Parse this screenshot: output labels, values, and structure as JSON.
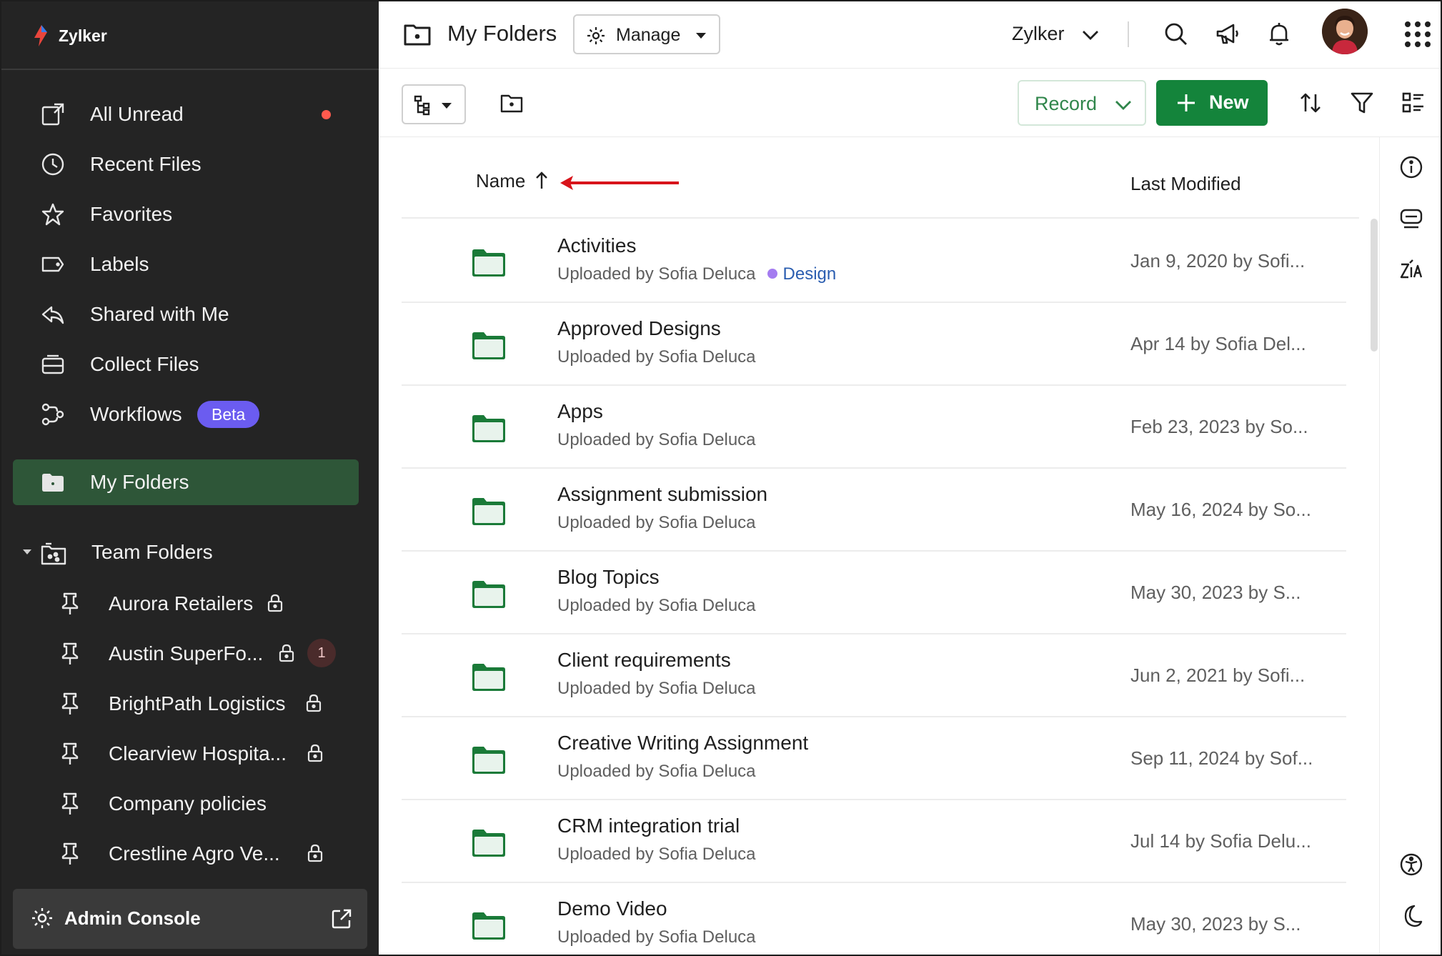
{
  "brand": {
    "name": "Zylker"
  },
  "sidebar": {
    "nav": [
      {
        "label": "All Unread",
        "icon": "all-unread-icon",
        "has_dot": true
      },
      {
        "label": "Recent Files",
        "icon": "clock-icon"
      },
      {
        "label": "Favorites",
        "icon": "star-icon"
      },
      {
        "label": "Labels",
        "icon": "label-icon"
      },
      {
        "label": "Shared with Me",
        "icon": "share-icon"
      },
      {
        "label": "Collect Files",
        "icon": "collect-icon"
      },
      {
        "label": "Workflows",
        "icon": "workflow-icon",
        "badge": "Beta"
      }
    ],
    "my_folders": {
      "label": "My Folders",
      "icon": "folder-icon",
      "active": true
    },
    "team_folders": {
      "label": "Team Folders",
      "items": [
        {
          "label": "Aurora Retailers",
          "locked": true
        },
        {
          "label": "Austin SuperFo...",
          "locked": true,
          "count": "1"
        },
        {
          "label": "BrightPath Logistics",
          "locked": true
        },
        {
          "label": "Clearview Hospita...",
          "locked": true
        },
        {
          "label": "Company policies",
          "locked": false
        },
        {
          "label": "Crestline Agro Ve...",
          "locked": true
        }
      ]
    },
    "admin": {
      "label": "Admin Console"
    }
  },
  "topbar": {
    "title": "My Folders",
    "manage_label": "Manage",
    "org_label": "Zylker"
  },
  "toolbar": {
    "record_label": "Record",
    "new_label": "New"
  },
  "list": {
    "col_name": "Name",
    "col_modified": "Last Modified",
    "rows": [
      {
        "name": "Activities",
        "sub": "Uploaded by Sofia Deluca",
        "tag": "Design",
        "modified": "Jan 9, 2020 by Sofi..."
      },
      {
        "name": "Approved Designs",
        "sub": "Uploaded by Sofia Deluca",
        "modified": "Apr 14 by Sofia Del..."
      },
      {
        "name": "Apps",
        "sub": "Uploaded by Sofia Deluca",
        "modified": "Feb 23, 2023 by So..."
      },
      {
        "name": "Assignment submission",
        "sub": "Uploaded by Sofia Deluca",
        "modified": "May 16, 2024 by So..."
      },
      {
        "name": "Blog Topics",
        "sub": "Uploaded by Sofia Deluca",
        "modified": "May 30, 2023 by S..."
      },
      {
        "name": "Client requirements",
        "sub": "Uploaded by Sofia Deluca",
        "modified": "Jun 2, 2021 by Sofi..."
      },
      {
        "name": "Creative Writing Assignment",
        "sub": "Uploaded by Sofia Deluca",
        "modified": "Sep 11, 2024 by Sof..."
      },
      {
        "name": "CRM integration trial",
        "sub": "Uploaded by Sofia Deluca",
        "modified": "Jul 14 by Sofia Delu..."
      },
      {
        "name": "Demo Video",
        "sub": "Uploaded by Sofia Deluca",
        "modified": "May 30, 2023 by S..."
      }
    ]
  },
  "colors": {
    "sidebar_bg": "#242424",
    "active_bg": "#2e5638",
    "accent_green": "#14843b",
    "beta_purple": "#6b5cf0",
    "unread_dot": "#ff5a4e",
    "annotation_red": "#d8141b"
  }
}
